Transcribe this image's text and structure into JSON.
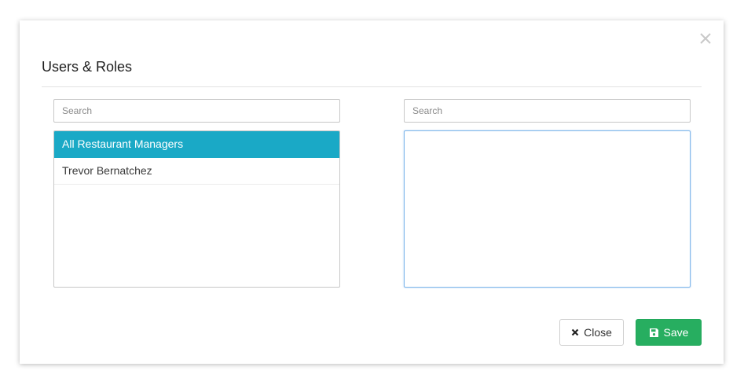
{
  "modal": {
    "title": "Users & Roles",
    "left_panel": {
      "search_placeholder": "Search",
      "items": [
        {
          "label": "All Restaurant Managers",
          "selected": true
        },
        {
          "label": "Trevor Bernatchez",
          "selected": false
        }
      ]
    },
    "right_panel": {
      "search_placeholder": "Search",
      "items": []
    },
    "buttons": {
      "close_label": "Close",
      "save_label": "Save"
    },
    "colors": {
      "selected_item": "#1aa9c6",
      "save_button": "#27ae60",
      "focus_border": "#7fb6ea"
    },
    "icons": {
      "dismiss": "close-x-icon",
      "close_button": "times-icon",
      "save_button": "floppy-disk-icon"
    }
  }
}
